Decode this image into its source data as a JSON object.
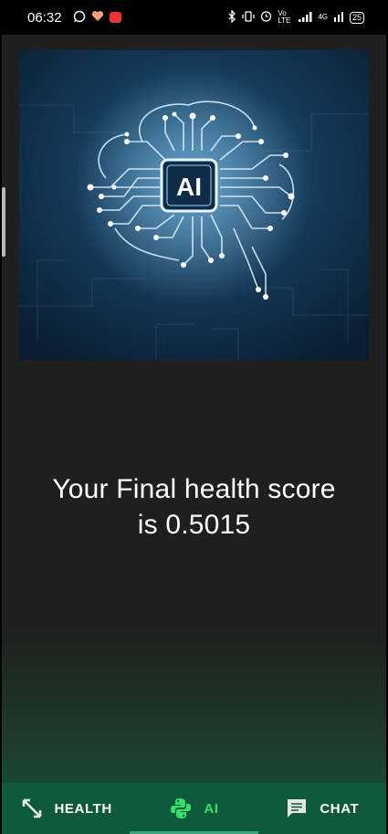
{
  "status_bar": {
    "time": "06:32",
    "left_icons": [
      "whatsapp-icon",
      "heart-pulse-icon",
      "recorder-icon"
    ],
    "right_icons": [
      "bluetooth-icon",
      "vibrate-icon",
      "alarm-icon",
      "volte-icon",
      "signal-icon",
      "signal-4g-icon"
    ],
    "volte_label": "Vo LTE",
    "network_label": "4G",
    "battery": "25"
  },
  "hero": {
    "chip_label": "AI"
  },
  "result": {
    "line1": "Your Final health score",
    "line2": "is 0.5015"
  },
  "nav": {
    "items": [
      {
        "label": "HEALTH",
        "icon": "expand-arrows-icon",
        "active": false
      },
      {
        "label": "AI",
        "icon": "python-icon",
        "active": true
      },
      {
        "label": "CHAT",
        "icon": "chat-icon",
        "active": false
      }
    ]
  },
  "colors": {
    "background": "#1e1f1e",
    "nav_background": "#0e5a3b",
    "active": "#34e06a",
    "text": "#ffffff"
  }
}
